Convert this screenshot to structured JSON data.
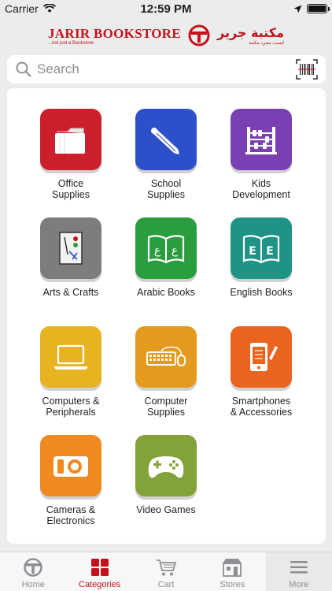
{
  "status": {
    "carrier": "Carrier",
    "time": "12:59 PM",
    "battery_level": 1.0
  },
  "header": {
    "brand_en": "JARIR BOOKSTORE",
    "tagline_en": "...not just a Bookstore",
    "brand_ar": "مكتبة جرير",
    "tagline_ar": "ليست مجرد مكتبة"
  },
  "search": {
    "placeholder": "Search"
  },
  "categories": [
    {
      "label": "Office\nSupplies",
      "icon": "folder-icon",
      "color": "#cc1f2c"
    },
    {
      "label": "School\nSupplies",
      "icon": "pencil-icon",
      "color": "#2d4fc9"
    },
    {
      "label": "Kids\nDevelopment",
      "icon": "abacus-icon",
      "color": "#7a3fb3"
    },
    {
      "label": "Arts & Crafts",
      "icon": "easel-icon",
      "color": "#7d7d80"
    },
    {
      "label": "Arabic Books",
      "icon": "arabic-book-icon",
      "color": "#2a9d3e"
    },
    {
      "label": "English Books",
      "icon": "english-book-icon",
      "color": "#1f9385"
    },
    {
      "label": "Computers &\nPeripherals",
      "icon": "laptop-icon",
      "color": "#e7b321"
    },
    {
      "label": "Computer\nSupplies",
      "icon": "keyboard-mouse-icon",
      "color": "#e39a1d"
    },
    {
      "label": "Smartphones\n& Accessories",
      "icon": "smartphone-icon",
      "color": "#ea6420"
    },
    {
      "label": "Cameras &\nElectronics",
      "icon": "camera-icon",
      "color": "#f08a1f"
    },
    {
      "label": "Video Games",
      "icon": "gamepad-icon",
      "color": "#82a23a"
    }
  ],
  "tabs": [
    {
      "label": "Home",
      "icon": "home-logo-icon",
      "active": false
    },
    {
      "label": "Categories",
      "icon": "categories-grid-icon",
      "active": true
    },
    {
      "label": "Cart",
      "icon": "cart-icon",
      "active": false
    },
    {
      "label": "Stores",
      "icon": "store-icon",
      "active": false
    },
    {
      "label": "More",
      "icon": "menu-icon",
      "active": false
    }
  ],
  "colors": {
    "brand": "#c4121a",
    "active_tab": "#c4121a",
    "inactive_tab": "#8e8e93"
  }
}
